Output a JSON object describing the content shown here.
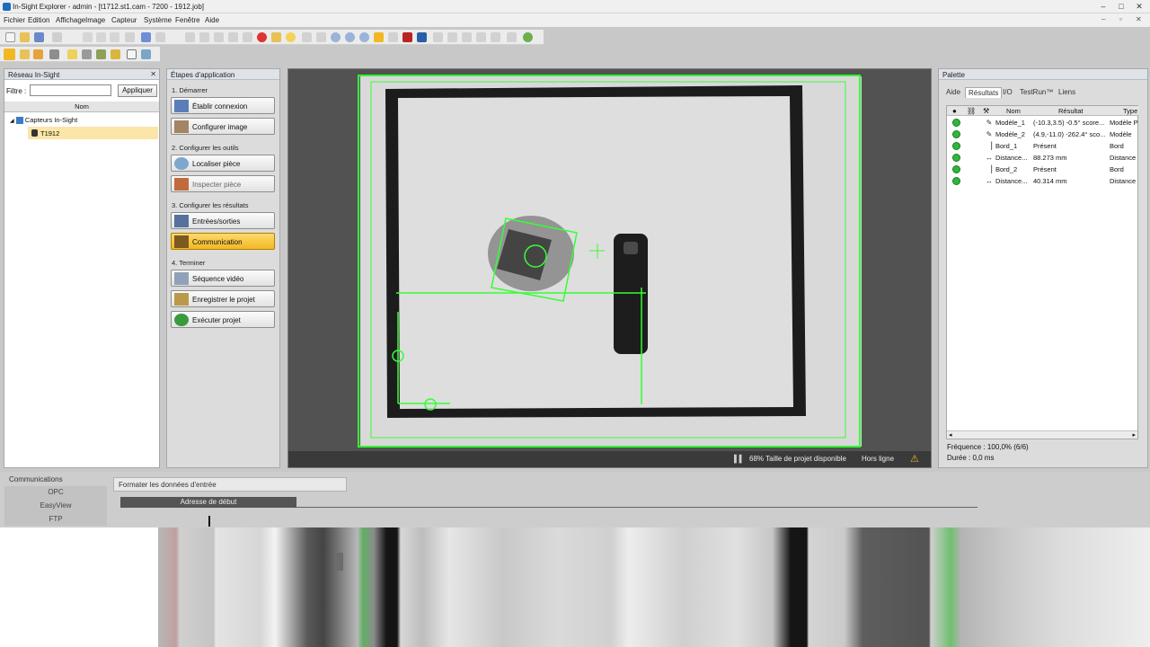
{
  "window": {
    "title": "In-Sight Explorer - admin - [t1712.st1.cam - 7200 - 1912.job]"
  },
  "menu": [
    "Fichier",
    "Edition",
    "Affichage",
    "Image",
    "Capteur",
    "Système",
    "Fenêtre",
    "Aide"
  ],
  "network_panel": {
    "title": "Réseau In-Sight",
    "filter_label": "Filtre :",
    "filter_value": "",
    "apply_label": "Appliquer",
    "column_header": "Nom",
    "tree": {
      "root": "Capteurs In-Sight",
      "child": "T1912"
    }
  },
  "app_steps": {
    "title": "Étapes d'application",
    "sections": [
      {
        "title": "1. Démarrer",
        "buttons": [
          "Établir connexion",
          "Configurer image"
        ]
      },
      {
        "title": "2. Configurer les outils",
        "buttons": [
          "Localiser pièce",
          "Inspecter pièce"
        ]
      },
      {
        "title": "3. Configurer les résultats",
        "buttons": [
          "Entrées/sorties",
          "Communication"
        ]
      },
      {
        "title": "4. Terminer",
        "buttons": [
          "Séquence vidéo",
          "Enregistrer le projet",
          "Exécuter projet"
        ]
      }
    ],
    "active_button": "Communication"
  },
  "viewer": {
    "project_size": "68% Taille de projet disponible",
    "status": "Hors ligne"
  },
  "palette": {
    "title": "Palette",
    "tabs": [
      "Aide",
      "Résultats",
      "I/O",
      "TestRun™",
      "Liens"
    ],
    "active_tab": "Résultats",
    "columns": [
      "Nom",
      "Résultat",
      "Type"
    ],
    "rows": [
      {
        "name": "Modèle_1",
        "result": "(-10.3,3.5) -0.5° score...",
        "type": "Modèle P"
      },
      {
        "name": "Modèle_2",
        "result": "(4.9,-11.0) -262.4° sco...",
        "type": "Modèle"
      },
      {
        "name": "Bord_1",
        "result": "Présent",
        "type": "Bord"
      },
      {
        "name": "Distance...",
        "result": "88.273 mm",
        "type": "Distance"
      },
      {
        "name": "Bord_2",
        "result": "Présent",
        "type": "Bord"
      },
      {
        "name": "Distance...",
        "result": "40.314 mm",
        "type": "Distance"
      }
    ],
    "frequency": "Fréquence : 100,0% (6/6)",
    "duration": "Durée : 0,0 ms"
  },
  "communications": {
    "title": "Communications",
    "items": [
      "OPC",
      "EasyView",
      "FTP"
    ],
    "format_tab": "Formater les données d'entrée",
    "start_address": "Adresse de début"
  },
  "colors": {
    "accent": "#f2b824",
    "overlay": "#35ff35",
    "status_ok": "#2db83a"
  }
}
